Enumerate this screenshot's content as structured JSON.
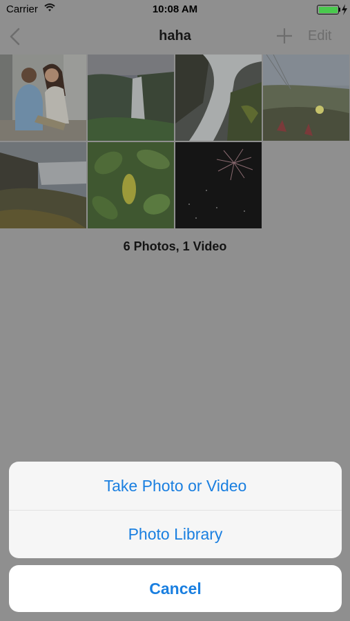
{
  "status_bar": {
    "carrier": "Carrier",
    "time": "10:08 AM",
    "battery_color": "#49c94d",
    "icons": [
      "wifi-icon",
      "battery-icon",
      "charging-bolt-icon"
    ]
  },
  "nav": {
    "back_icon": "chevron-left-icon",
    "title": "haha",
    "add_icon": "plus-icon",
    "edit_label": "Edit"
  },
  "photos": [
    {
      "id": 1,
      "subject": "couple"
    },
    {
      "id": 2,
      "subject": "waterfall"
    },
    {
      "id": 3,
      "subject": "waterfall-rocks"
    },
    {
      "id": 4,
      "subject": "coastal-flowers"
    },
    {
      "id": 5,
      "subject": "waterfall-cliffs"
    },
    {
      "id": 6,
      "subject": "green-leaves"
    },
    {
      "id": 7,
      "subject": "fireworks"
    }
  ],
  "summary": "6 Photos, 1 Video",
  "action_sheet": {
    "take_photo_label": "Take Photo or Video",
    "library_label": "Photo Library",
    "cancel_label": "Cancel",
    "accent_color": "#1a7fe0"
  }
}
